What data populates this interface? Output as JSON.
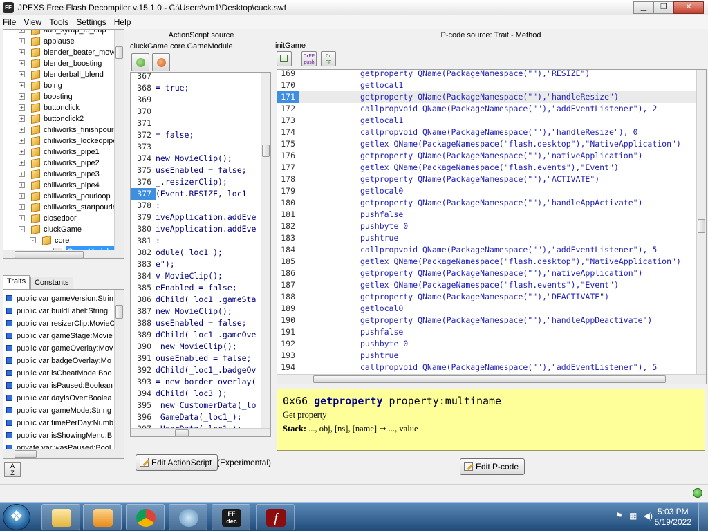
{
  "window": {
    "title": "JPEXS Free Flash Decompiler v.15.1.0 - C:\\Users\\vm1\\Desktop\\cuck.swf",
    "app_icon_text": "FF"
  },
  "menu": [
    "File",
    "View",
    "Tools",
    "Settings",
    "Help"
  ],
  "tree": {
    "items": [
      {
        "label": "add_syrup_to_cup",
        "depth": 1,
        "expander": "+"
      },
      {
        "label": "applause",
        "depth": 1,
        "expander": "+"
      },
      {
        "label": "blender_beater_move",
        "depth": 1,
        "expander": "+"
      },
      {
        "label": "blender_boosting",
        "depth": 1,
        "expander": "+"
      },
      {
        "label": "blenderball_blend",
        "depth": 1,
        "expander": "+"
      },
      {
        "label": "boing",
        "depth": 1,
        "expander": "+"
      },
      {
        "label": "boosting",
        "depth": 1,
        "expander": "+"
      },
      {
        "label": "buttonclick",
        "depth": 1,
        "expander": "+"
      },
      {
        "label": "buttonclick2",
        "depth": 1,
        "expander": "+"
      },
      {
        "label": "chiliworks_finishpourin",
        "depth": 1,
        "expander": "+"
      },
      {
        "label": "chiliworks_lockedpipe",
        "depth": 1,
        "expander": "+"
      },
      {
        "label": "chiliworks_pipe1",
        "depth": 1,
        "expander": "+"
      },
      {
        "label": "chiliworks_pipe2",
        "depth": 1,
        "expander": "+"
      },
      {
        "label": "chiliworks_pipe3",
        "depth": 1,
        "expander": "+"
      },
      {
        "label": "chiliworks_pipe4",
        "depth": 1,
        "expander": "+"
      },
      {
        "label": "chiliworks_pourloop",
        "depth": 1,
        "expander": "+"
      },
      {
        "label": "chiliworks_startpourin",
        "depth": 1,
        "expander": "+"
      },
      {
        "label": "closedoor",
        "depth": 1,
        "expander": "+"
      },
      {
        "label": "cluckGame",
        "depth": 1,
        "expander": "-"
      },
      {
        "label": "core",
        "depth": 2,
        "expander": "-"
      },
      {
        "label": "GameModule",
        "depth": 3,
        "expander": "",
        "selected": true
      }
    ]
  },
  "tabs": [
    {
      "label": "Traits",
      "active": true
    },
    {
      "label": "Constants",
      "active": false
    }
  ],
  "traits": [
    "public var gameVersion:Strin",
    "public var buildLabel:String",
    "public var resizerClip:MovieC",
    "public var gameStage:Movie",
    "public var gameOverlay:Mov",
    "public var badgeOverlay:Mo",
    "public var isCheatMode:Boo",
    "public var isPaused:Boolean",
    "public var dayIsOver:Boolea",
    "public var gameMode:String",
    "public var timePerDay:Numb",
    "public var isShowingMenu:B",
    "private var wasPaused:Bool"
  ],
  "sort_button_text": "A\nZ",
  "actionscript": {
    "header": "ActionScript source",
    "class_name": "cluckGame.core.GameModule",
    "lines": [
      {
        "n": "367",
        "t": ""
      },
      {
        "n": "368",
        "t": "= true;"
      },
      {
        "n": "369",
        "t": ""
      },
      {
        "n": "370",
        "t": ""
      },
      {
        "n": "371",
        "t": ""
      },
      {
        "n": "372",
        "t": "= false;"
      },
      {
        "n": "373",
        "t": ""
      },
      {
        "n": "374",
        "t": "new MovieClip();"
      },
      {
        "n": "375",
        "t": "useEnabled = false;"
      },
      {
        "n": "376",
        "t": "_.resizerClip);"
      },
      {
        "n": "377",
        "t": "(Event.RESIZE,_loc1_",
        "current": true
      },
      {
        "n": "378",
        "t": ":"
      },
      {
        "n": "379",
        "t": "iveApplication.addEve"
      },
      {
        "n": "380",
        "t": "iveApplication.addEve"
      },
      {
        "n": "381",
        "t": ":"
      },
      {
        "n": "382",
        "t": "odule(_loc1_);"
      },
      {
        "n": "383",
        "t": "e\");"
      },
      {
        "n": "384",
        "t": "v MovieClip();"
      },
      {
        "n": "385",
        "t": "eEnabled = false;"
      },
      {
        "n": "386",
        "t": "dChild(_loc1_.gameSta"
      },
      {
        "n": "387",
        "t": "new MovieClip();"
      },
      {
        "n": "388",
        "t": "useEnabled = false;"
      },
      {
        "n": "389",
        "t": "dChild(_loc1_.gameOve"
      },
      {
        "n": "390",
        "t": " new MovieClip();"
      },
      {
        "n": "391",
        "t": "ouseEnabled = false;"
      },
      {
        "n": "392",
        "t": "dChild(_loc1_.badgeOv"
      },
      {
        "n": "393",
        "t": "= new border_overlay("
      },
      {
        "n": "394",
        "t": "dChild(_loc3_);"
      },
      {
        "n": "395",
        "t": " new CustomerData(_lo"
      },
      {
        "n": "396",
        "t": " GameData(_loc1_);"
      },
      {
        "n": "397",
        "t": " UserData(_loc1_);"
      }
    ],
    "edit_button": "Edit ActionScript",
    "experimental": "(Experimental)"
  },
  "pcode": {
    "header": "P-code source: Trait - Method",
    "method": "initGame",
    "toolbar": [
      {
        "name": "graph",
        "text": "o\n[]"
      },
      {
        "name": "hex",
        "text": "0xFF\npush"
      },
      {
        "name": "hex2",
        "text": "0x\nFF"
      }
    ],
    "lines": [
      {
        "n": "169",
        "t": "getproperty QName(PackageNamespace(\"\"),\"RESIZE\")"
      },
      {
        "n": "170",
        "t": "getlocal1"
      },
      {
        "n": "171",
        "t": "getproperty QName(PackageNamespace(\"\"),\"handleResize\")",
        "current": true
      },
      {
        "n": "172",
        "t": "callpropvoid QName(PackageNamespace(\"\"),\"addEventListener\"), 2"
      },
      {
        "n": "173",
        "t": "getlocal1"
      },
      {
        "n": "174",
        "t": "callpropvoid QName(PackageNamespace(\"\"),\"handleResize\"), 0"
      },
      {
        "n": "175",
        "t": "getlex QName(PackageNamespace(\"flash.desktop\"),\"NativeApplication\")"
      },
      {
        "n": "176",
        "t": "getproperty QName(PackageNamespace(\"\"),\"nativeApplication\")"
      },
      {
        "n": "177",
        "t": "getlex QName(PackageNamespace(\"flash.events\"),\"Event\")"
      },
      {
        "n": "178",
        "t": "getproperty QName(PackageNamespace(\"\"),\"ACTIVATE\")"
      },
      {
        "n": "179",
        "t": "getlocal0"
      },
      {
        "n": "180",
        "t": "getproperty QName(PackageNamespace(\"\"),\"handleAppActivate\")"
      },
      {
        "n": "181",
        "t": "pushfalse"
      },
      {
        "n": "182",
        "t": "pushbyte 0"
      },
      {
        "n": "183",
        "t": "pushtrue"
      },
      {
        "n": "184",
        "t": "callpropvoid QName(PackageNamespace(\"\"),\"addEventListener\"), 5"
      },
      {
        "n": "185",
        "t": "getlex QName(PackageNamespace(\"flash.desktop\"),\"NativeApplication\")"
      },
      {
        "n": "186",
        "t": "getproperty QName(PackageNamespace(\"\"),\"nativeApplication\")"
      },
      {
        "n": "187",
        "t": "getlex QName(PackageNamespace(\"flash.events\"),\"Event\")"
      },
      {
        "n": "188",
        "t": "getproperty QName(PackageNamespace(\"\"),\"DEACTIVATE\")"
      },
      {
        "n": "189",
        "t": "getlocal0"
      },
      {
        "n": "190",
        "t": "getproperty QName(PackageNamespace(\"\"),\"handleAppDeactivate\")"
      },
      {
        "n": "191",
        "t": "pushfalse"
      },
      {
        "n": "192",
        "t": "pushbyte 0"
      },
      {
        "n": "193",
        "t": "pushtrue"
      },
      {
        "n": "194",
        "t": "callpropvoid QName(PackageNamespace(\"\"),\"addEventListener\"), 5"
      }
    ],
    "doc": {
      "opcode": "0x66",
      "name": "getproperty",
      "operand": "property:multiname",
      "description": "Get property",
      "stack_label": "Stack:",
      "stack": "..., obj, [ns], [name] ➞ ..., value"
    },
    "edit_button": "Edit P-code"
  },
  "taskbar": {
    "time": "5:03 PM",
    "date": "5/19/2022",
    "app_ff_text": "FF\ndec"
  }
}
